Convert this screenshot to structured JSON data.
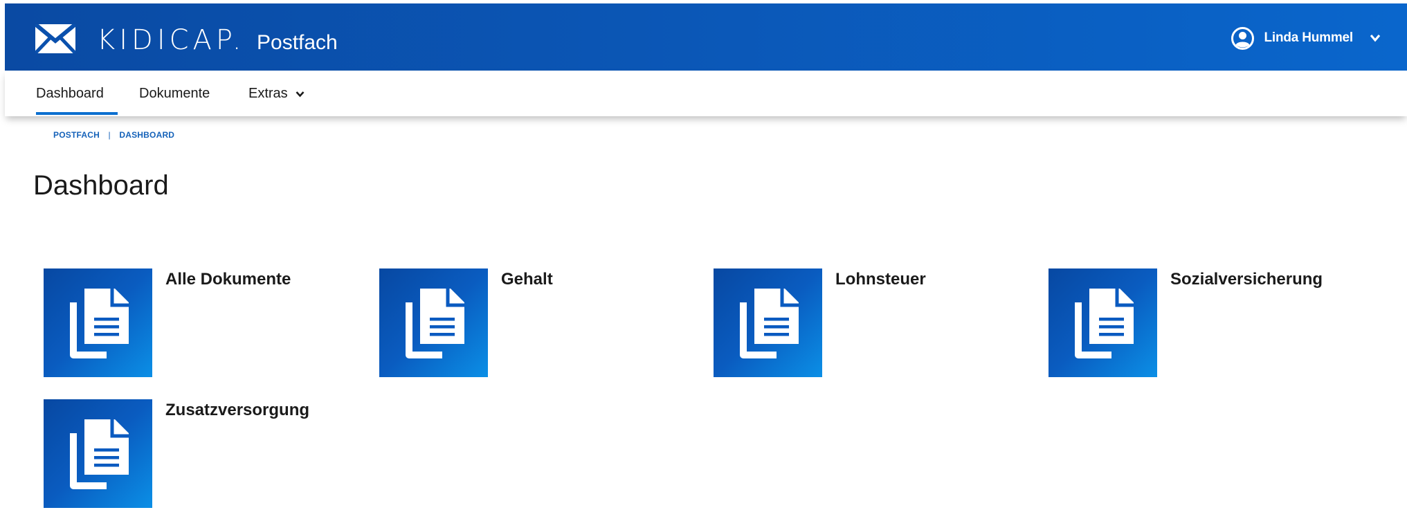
{
  "app": {
    "brand_name": "KIDICAP.",
    "brand_sub": "Postfach",
    "user_name": "Linda Hummel"
  },
  "nav": {
    "items": [
      {
        "label": "Dashboard",
        "active": true
      },
      {
        "label": "Dokumente",
        "active": false
      },
      {
        "label": "Extras",
        "active": false,
        "has_dropdown": true
      }
    ]
  },
  "breadcrumb": {
    "items": [
      "POSTFACH",
      "DASHBOARD"
    ]
  },
  "page": {
    "title": "Dashboard"
  },
  "tiles": [
    {
      "label": "Alle Dokumente",
      "icon": "documents-icon"
    },
    {
      "label": "Gehalt",
      "icon": "documents-icon"
    },
    {
      "label": "Lohnsteuer",
      "icon": "documents-icon"
    },
    {
      "label": "Sozialversicherung",
      "icon": "documents-icon"
    },
    {
      "label": "Zusatzversorgung",
      "icon": "documents-icon"
    }
  ],
  "colors": {
    "header_blue": "#0b56b5",
    "accent": "#0b6fd0",
    "breadcrumb": "#1562b9"
  }
}
